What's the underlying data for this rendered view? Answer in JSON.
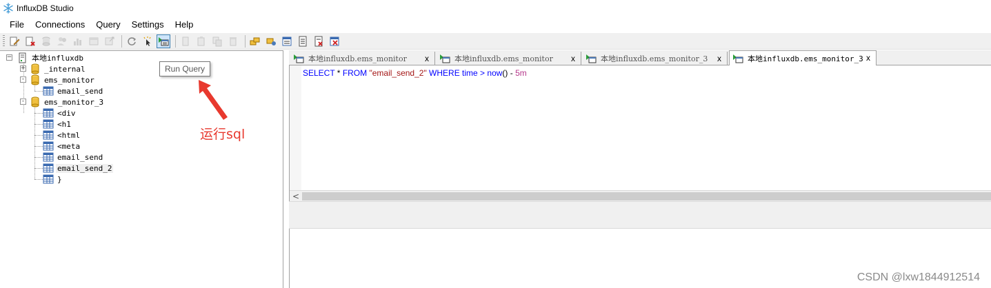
{
  "window": {
    "title": "InfluxDB Studio",
    "icon": "snowflake-icon"
  },
  "menu": {
    "items": [
      {
        "label": "File"
      },
      {
        "label": "Connections"
      },
      {
        "label": "Query"
      },
      {
        "label": "Settings"
      },
      {
        "label": "Help"
      }
    ]
  },
  "toolbar": {
    "tooltip": "Run Query"
  },
  "tree": {
    "root": "本地influxdb",
    "databases": [
      {
        "name": "_internal",
        "expander": "+",
        "children": []
      },
      {
        "name": "ems_monitor",
        "expander": "-",
        "children": [
          "email_send"
        ]
      },
      {
        "name": "ems_monitor_3",
        "expander": "-",
        "children": [
          "<div",
          "<h1",
          "<html",
          "<meta",
          "email_send",
          "email_send_2",
          "}"
        ]
      }
    ]
  },
  "annotation": {
    "text": "运行sql",
    "color": "#e8392e"
  },
  "tabs": [
    {
      "label": "本地influxdb.ems_monitor",
      "close": "x"
    },
    {
      "label": "本地influxdb.ems_monitor",
      "close": "x"
    },
    {
      "label": "本地influxdb.ems_monitor_3",
      "close": "x"
    },
    {
      "label": "本地influxdb.ems_monitor_3",
      "close": "x",
      "active": true
    }
  ],
  "editor": {
    "query": {
      "p1": "SELECT",
      "p2": " * ",
      "p3": "FROM",
      "p4": " \"email_send_2\" ",
      "p5": "WHERE",
      "p6": " time > ",
      "p7": "now",
      "p8": "() - ",
      "p9": "5m"
    }
  },
  "scroll": {
    "left_arrow": "<"
  },
  "watermark": "CSDN @lxw1844912514",
  "colors": {
    "selection": "#cfe5fa",
    "string": "#a31515",
    "keyword": "#0000ff"
  }
}
